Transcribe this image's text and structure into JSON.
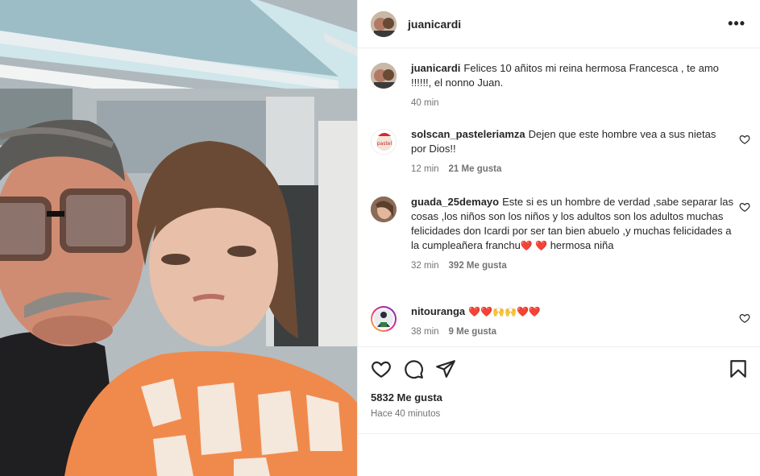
{
  "post": {
    "author": "juanicardi",
    "likes_label": "5832 Me gusta",
    "time_ago": "Hace 40 minutos",
    "photo": "photo of a grandfather with glasses and a young girl in an orange shirt"
  },
  "caption": {
    "user": "juanicardi",
    "text": "Felices 10 añitos mi reina hermosa Francesca , te amo !!!!!!, el nonno Juan.",
    "time": "40 min"
  },
  "comments": [
    {
      "user": "solscan_pasteleriamza",
      "text": "Dejen que este hombre vea a sus nietas por Dios!!",
      "time": "12 min",
      "likes": "21 Me gusta"
    },
    {
      "user": "guada_25demayo",
      "text": "Este si es un hombre de verdad ,sabe separar las cosas ,los niños son los niños y los adultos son los adultos muchas felicidades don Icardi por ser tan bien abuelo ,y muchas felicidades a la cumpleañera franchu",
      "text_tail": "hermosa niña",
      "emoji_mid": "❤️ ❤️",
      "time": "32 min",
      "likes": "392 Me gusta"
    },
    {
      "user": "nitouranga",
      "text": "",
      "emoji": "❤️❤️🙌🙌❤️❤️",
      "time": "38 min",
      "likes": "9 Me gusta"
    }
  ],
  "icons": {
    "more": "more-options-icon",
    "like": "heart-icon",
    "comment": "comment-bubble-icon",
    "share": "paper-plane-icon",
    "save": "bookmark-icon"
  },
  "colors": {
    "text": "#262626",
    "secondary": "#737373",
    "divider": "#efefef",
    "heart": "#ed1c24"
  }
}
